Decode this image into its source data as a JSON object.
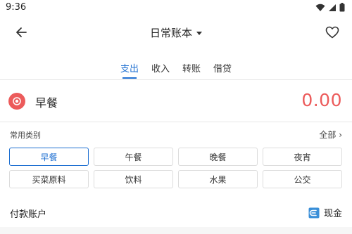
{
  "status_bar": {
    "time": "9:36"
  },
  "app_bar": {
    "title": "日常账本"
  },
  "tabs": [
    {
      "label": "支出",
      "active": true
    },
    {
      "label": "收入",
      "active": false
    },
    {
      "label": "转账",
      "active": false
    },
    {
      "label": "借贷",
      "active": false
    }
  ],
  "entry": {
    "category": "早餐",
    "amount": "0.00",
    "accent_color": "#ec5b5b"
  },
  "common_categories": {
    "label": "常用类别",
    "all_label": "全部",
    "items": [
      {
        "label": "早餐",
        "selected": true
      },
      {
        "label": "午餐",
        "selected": false
      },
      {
        "label": "晚餐",
        "selected": false
      },
      {
        "label": "夜宵",
        "selected": false
      },
      {
        "label": "买菜原料",
        "selected": false
      },
      {
        "label": "饮料",
        "selected": false
      },
      {
        "label": "水果",
        "selected": false
      },
      {
        "label": "公交",
        "selected": false
      }
    ]
  },
  "payment_account": {
    "label": "付款账户",
    "value": "现金"
  },
  "colors": {
    "accent": "#1e6fd1",
    "expense": "#ec5b5b"
  }
}
